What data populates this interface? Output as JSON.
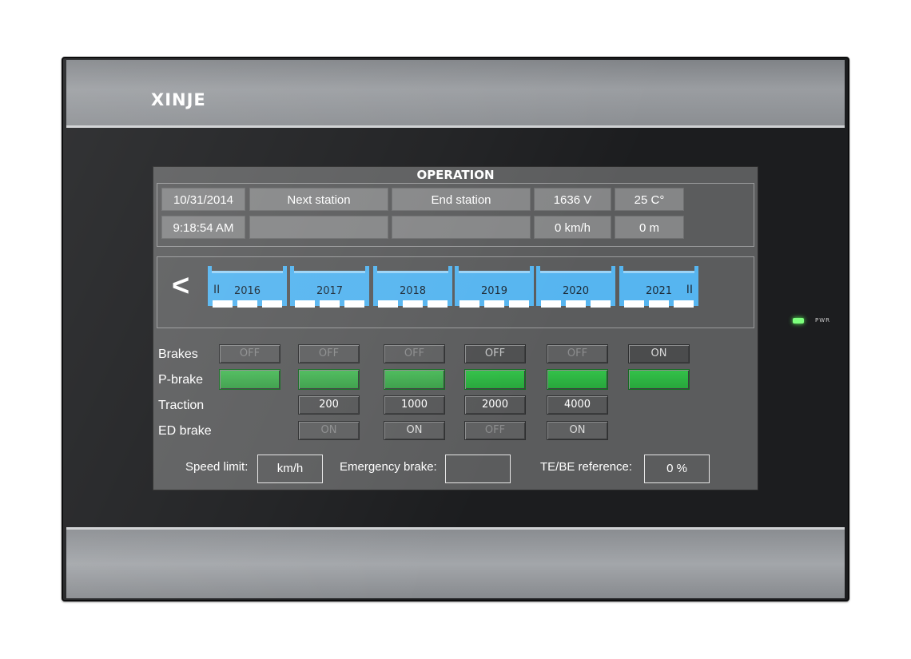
{
  "brand": "XINJE",
  "power_label": "PWR",
  "screen": {
    "title": "OPERATION",
    "info": {
      "date": "10/31/2014",
      "time": "9:18:54 AM",
      "next_station_label": "Next station",
      "next_station_value": "",
      "end_station_label": "End station",
      "end_station_value": "",
      "voltage": "1636 V",
      "speed": "0 km/h",
      "temperature": "25 C°",
      "distance": "0 m"
    },
    "train": {
      "back_symbol": "<",
      "end_marker": "II",
      "cars": [
        "2016",
        "2017",
        "2018",
        "2019",
        "2020",
        "2021"
      ]
    },
    "rows": {
      "brakes_label": "Brakes",
      "pbrake_label": "P-brake",
      "traction_label": "Traction",
      "edbrake_label": "ED brake"
    },
    "brakes": [
      "OFF",
      "OFF",
      "OFF",
      "OFF",
      "OFF",
      "ON"
    ],
    "traction": [
      "200",
      "1000",
      "2000",
      "4000"
    ],
    "ed_brake": [
      "ON",
      "ON",
      "OFF",
      "ON"
    ],
    "footer": {
      "speed_limit_label": "Speed limit:",
      "speed_limit_value": "km/h",
      "emergency_brake_label": "Emergency brake:",
      "emergency_brake_value": "",
      "te_be_label": "TE/BE reference:",
      "te_be_value": "0 %"
    }
  },
  "colors": {
    "car_blue": "#56b5f0",
    "brake_green": "#2bb140",
    "led_green": "#7dff7d"
  }
}
